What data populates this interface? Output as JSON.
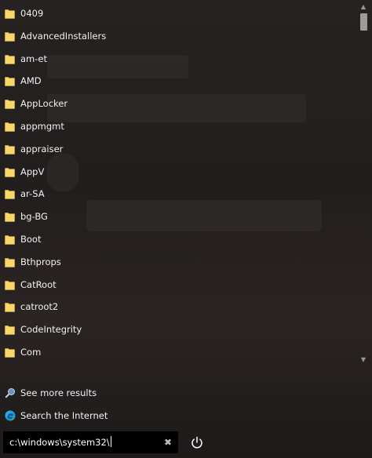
{
  "results": {
    "items": [
      {
        "label": "0409"
      },
      {
        "label": "AdvancedInstallers"
      },
      {
        "label": "am-et"
      },
      {
        "label": "AMD"
      },
      {
        "label": "AppLocker"
      },
      {
        "label": "appmgmt"
      },
      {
        "label": "appraiser"
      },
      {
        "label": "AppV"
      },
      {
        "label": "ar-SA"
      },
      {
        "label": "bg-BG"
      },
      {
        "label": "Boot"
      },
      {
        "label": "Bthprops"
      },
      {
        "label": "CatRoot"
      },
      {
        "label": "catroot2"
      },
      {
        "label": "CodeIntegrity"
      },
      {
        "label": "Com"
      }
    ],
    "item_icon": "folder-icon",
    "folder_color": "#f7d66b"
  },
  "actions": {
    "see_more": {
      "label": "See more results",
      "icon": "search-icon"
    },
    "search_internet": {
      "label": "Search the Internet",
      "icon": "edge-browser-icon"
    }
  },
  "search": {
    "value": "c:\\windows\\system32\\",
    "clear_icon": "close-icon"
  },
  "power": {
    "icon": "power-icon"
  },
  "scrollbar": {
    "up_icon": "scroll-up-icon",
    "down_icon": "scroll-down-icon"
  }
}
